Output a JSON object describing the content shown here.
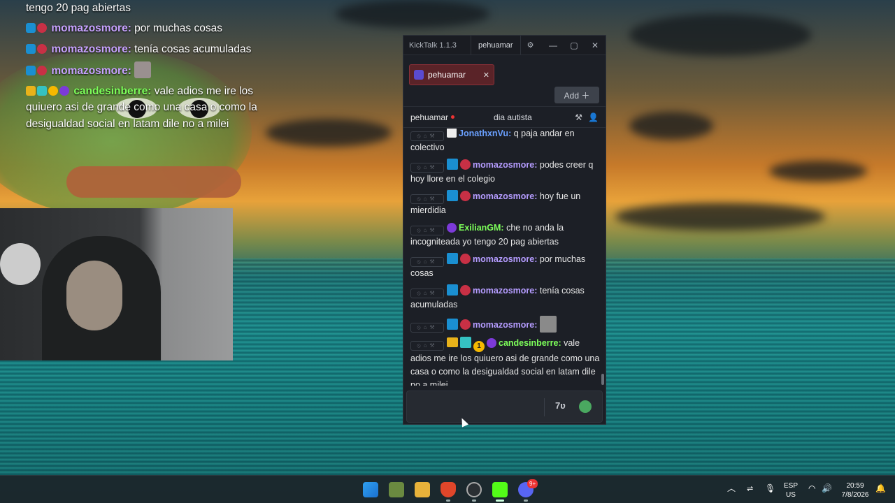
{
  "overlay_chat": {
    "line0": "tengo 20 pag abiertas",
    "line1_user": "momazosmore:",
    "line1_text": " por muchas cosas",
    "line2_user": "momazosmore:",
    "line2_text": " tenía cosas acumuladas",
    "line3_user": "momazosmore:",
    "line4_user": "candesinberre:",
    "line4_text": " vale adios me ire los quiuero asi de grande como una casa o como la desigualdad social en latam dile no a milei"
  },
  "kicktalk": {
    "app_title": "KickTalk 1.1.3",
    "title_channel": "pehuamar",
    "channel_tab_label": "pehuamar",
    "add_label": "Add ＋",
    "header_channel": "pehuamar",
    "stream_title": "dia autista",
    "messages": [
      {
        "user": "JonathxnVu:",
        "text": " q paja andar en colectivo"
      },
      {
        "user": "momazosmore:",
        "text": " podes creer q hoy llore en el colegio"
      },
      {
        "user": "momazosmore:",
        "text": " hoy fue un mierdidia"
      },
      {
        "user": "ExilianGM:",
        "text": " che no anda la incogniteada yo tengo 20 pag abiertas"
      },
      {
        "user": "momazosmore:",
        "text": " por muchas cosas"
      },
      {
        "user": "momazosmore:",
        "text": " tenía cosas acumuladas"
      },
      {
        "user": "momazosmore:",
        "text": ""
      },
      {
        "user": "candesinberre:",
        "text": " vale adios me ire los quiuero asi de grande como una casa o como la desigualdad social en latam dile no a milei"
      }
    ],
    "input_placeholder": ""
  },
  "taskbar": {
    "lang_top": "ESP",
    "lang_bottom": "US",
    "time": "20:59",
    "date": "7/8/2026",
    "discord_badge": "9+"
  },
  "colors": {
    "kick_green": "#53fc18",
    "purple_user": "#b59cff",
    "green_user": "#7dff5a"
  }
}
